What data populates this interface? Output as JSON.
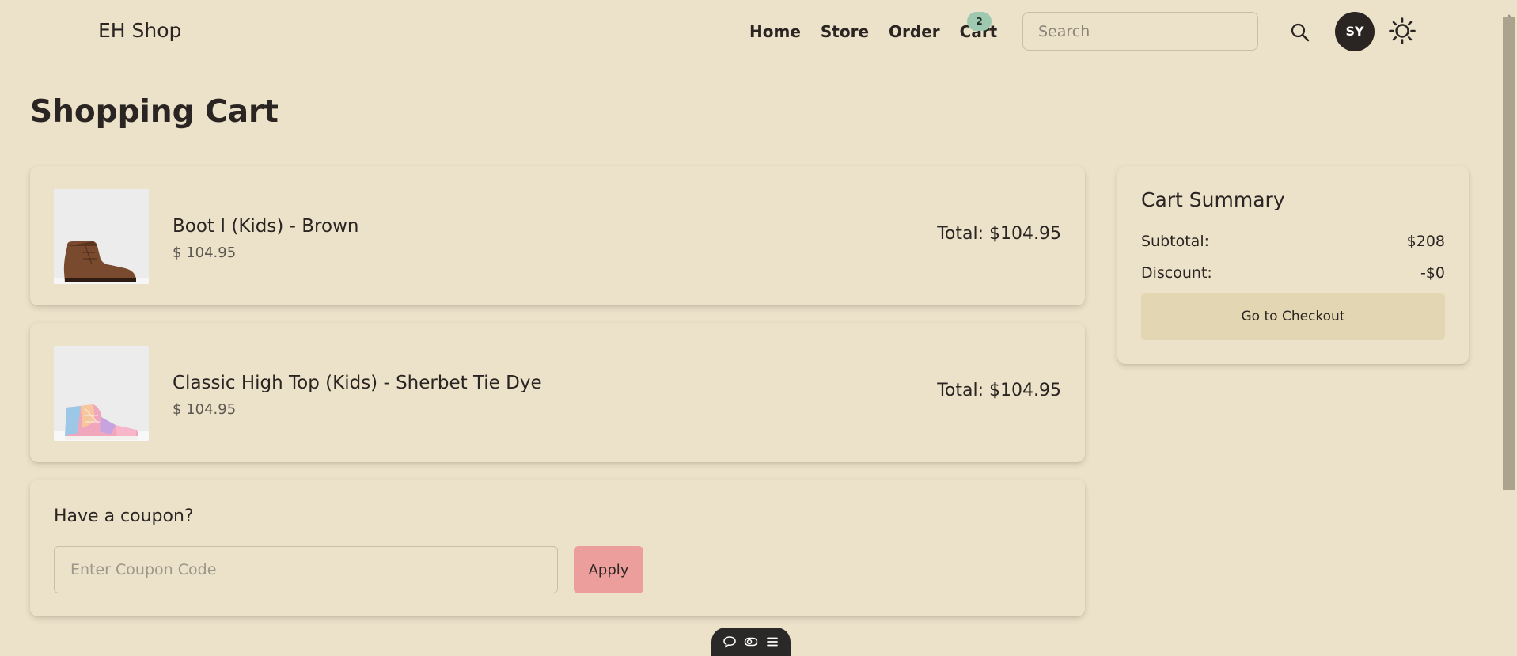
{
  "brand": "EH Shop",
  "nav": {
    "links": [
      "Home",
      "Store",
      "Order",
      "Cart"
    ],
    "cart_count": "2"
  },
  "search": {
    "placeholder": "Search"
  },
  "user": {
    "initials": "SY"
  },
  "page_title": "Shopping Cart",
  "cart_items": [
    {
      "name": "Boot I (Kids) - Brown",
      "price": "$ 104.95",
      "total": "Total: $104.95"
    },
    {
      "name": "Classic High Top (Kids) - Sherbet Tie Dye",
      "price": "$ 104.95",
      "total": "Total: $104.95"
    }
  ],
  "coupon": {
    "title": "Have a coupon?",
    "placeholder": "Enter Coupon Code",
    "apply_label": "Apply"
  },
  "summary": {
    "title": "Cart Summary",
    "subtotal_label": "Subtotal:",
    "subtotal_value": "$208",
    "discount_label": "Discount:",
    "discount_value": "-$0",
    "checkout_label": "Go to Checkout"
  },
  "colors": {
    "background": "#ece2c9",
    "text": "#2a2522",
    "cart_badge": "#9fc8b0",
    "apply_button": "#eb9e9b",
    "checkout_button": "#e3d6b2",
    "avatar": "#2a2522"
  },
  "icons": {
    "search": "search-icon",
    "theme": "sun-icon",
    "toolbar": [
      "chat-icon",
      "toggle-icon",
      "menu-icon"
    ]
  }
}
